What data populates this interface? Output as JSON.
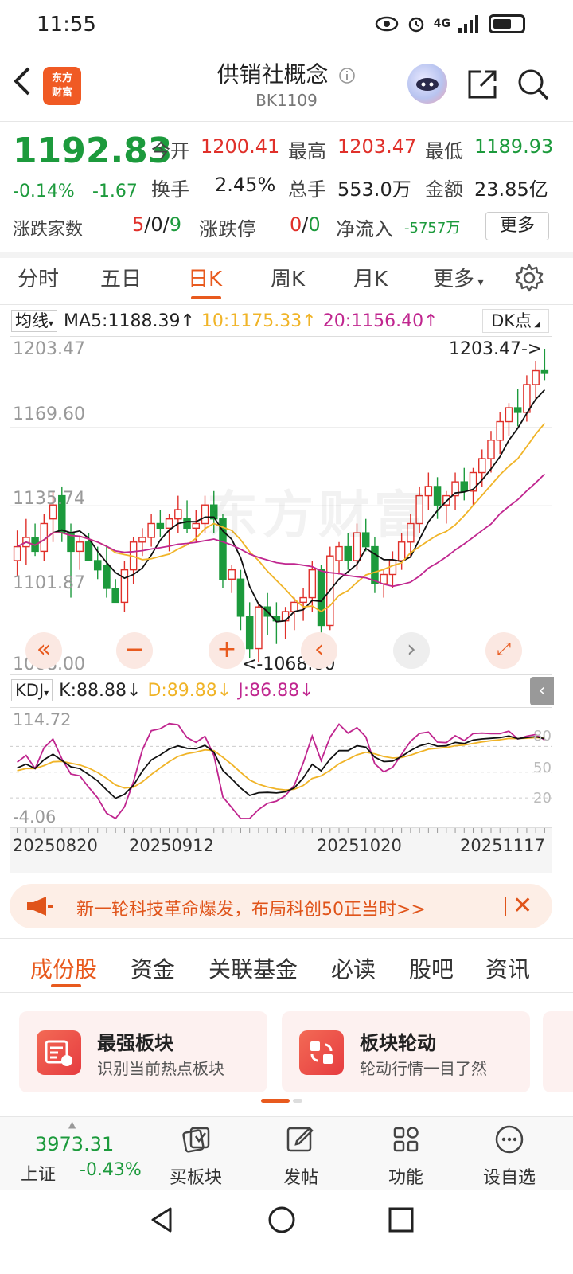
{
  "status": {
    "time": "11:55",
    "network": "4G"
  },
  "header": {
    "logo_line1": "东方",
    "logo_line2": "财富",
    "title": "供销社概念",
    "code": "BK1109",
    "icons": [
      "back-arrow-icon",
      "info-icon",
      "assistant-avatar",
      "share-icon",
      "search-icon"
    ]
  },
  "quote": {
    "price": "1192.83",
    "change_pct": "-0.14%",
    "change_abs": "-1.67",
    "open_label": "今开",
    "open": "1200.41",
    "high_label": "最高",
    "high": "1203.47",
    "low_label": "最低",
    "low": "1189.93",
    "turnover_label": "换手",
    "turnover": "2.45%",
    "volume_label": "总手",
    "volume": "553.0万",
    "amount_label": "金额",
    "amount": "23.85亿",
    "breadth_label": "涨跌家数",
    "breadth_up": "5",
    "breadth_flat": "0",
    "breadth_down": "9",
    "limit_label": "涨跌停",
    "limit_up": "0",
    "limit_down": "0",
    "netflow_label": "净流入",
    "netflow": "-5757万",
    "more_label": "更多",
    "colors": {
      "up": "#e0302a",
      "down": "#1c9a3c"
    }
  },
  "period_tabs": [
    "分时",
    "五日",
    "日K",
    "周K",
    "月K",
    "更多"
  ],
  "active_period": "日K",
  "ma": {
    "selector": "均线",
    "ma5": "MA5:1188.39",
    "ma10": "10:1175.33",
    "ma20": "20:1156.40",
    "dk_label": "DK点",
    "colors": {
      "ma5": "#111111",
      "ma10": "#f0b428",
      "ma20": "#c0268f"
    }
  },
  "kline": {
    "y_labels": [
      "1203.47",
      "1169.60",
      "1135.74",
      "1101.87",
      "1068.00"
    ],
    "max_marker": "1203.47->",
    "min_marker": "<-1068.00",
    "watermark": "东方财富"
  },
  "kdj": {
    "selector": "KDJ",
    "k": "K:88.88",
    "d": "D:89.88",
    "j": "J:86.88",
    "y_top": "114.72",
    "y_bottom": "-4.06",
    "y_ticks": [
      "80",
      "50",
      "20"
    ]
  },
  "chart_data": {
    "type": "candlestick",
    "title": "供销社概念 BK1109 日K",
    "y_range": [
      1068.0,
      1203.47
    ],
    "x_labels": [
      "20250820",
      "20250912",
      "20251020",
      "20251117"
    ],
    "ohlc_approx": [
      [
        1112,
        1125,
        1105,
        1118
      ],
      [
        1118,
        1130,
        1110,
        1122
      ],
      [
        1122,
        1128,
        1114,
        1116
      ],
      [
        1116,
        1132,
        1112,
        1128
      ],
      [
        1130,
        1142,
        1120,
        1136
      ],
      [
        1140,
        1144,
        1120,
        1124
      ],
      [
        1124,
        1128,
        1096,
        1116
      ],
      [
        1116,
        1122,
        1108,
        1120
      ],
      [
        1120,
        1124,
        1112,
        1112
      ],
      [
        1112,
        1118,
        1104,
        1108
      ],
      [
        1110,
        1118,
        1096,
        1100
      ],
      [
        1100,
        1104,
        1094,
        1094
      ],
      [
        1094,
        1112,
        1090,
        1108
      ],
      [
        1108,
        1122,
        1102,
        1120
      ],
      [
        1120,
        1126,
        1114,
        1122
      ],
      [
        1122,
        1132,
        1118,
        1128
      ],
      [
        1128,
        1134,
        1122,
        1126
      ],
      [
        1126,
        1132,
        1116,
        1130
      ],
      [
        1130,
        1140,
        1124,
        1134
      ],
      [
        1130,
        1138,
        1124,
        1126
      ],
      [
        1126,
        1134,
        1120,
        1128
      ],
      [
        1128,
        1140,
        1124,
        1136
      ],
      [
        1136,
        1142,
        1124,
        1130
      ],
      [
        1130,
        1132,
        1100,
        1104
      ],
      [
        1104,
        1110,
        1098,
        1108
      ],
      [
        1104,
        1108,
        1082,
        1088
      ],
      [
        1088,
        1094,
        1070,
        1074
      ],
      [
        1074,
        1094,
        1068,
        1092
      ],
      [
        1092,
        1098,
        1080,
        1088
      ],
      [
        1088,
        1094,
        1076,
        1086
      ],
      [
        1086,
        1092,
        1078,
        1090
      ],
      [
        1090,
        1096,
        1082,
        1094
      ],
      [
        1094,
        1100,
        1086,
        1096
      ],
      [
        1096,
        1112,
        1090,
        1108
      ],
      [
        1108,
        1110,
        1080,
        1084
      ],
      [
        1084,
        1118,
        1082,
        1114
      ],
      [
        1112,
        1120,
        1106,
        1118
      ],
      [
        1118,
        1124,
        1108,
        1112
      ],
      [
        1112,
        1128,
        1108,
        1124
      ],
      [
        1124,
        1130,
        1116,
        1118
      ],
      [
        1118,
        1122,
        1098,
        1102
      ],
      [
        1102,
        1108,
        1096,
        1106
      ],
      [
        1106,
        1116,
        1100,
        1112
      ],
      [
        1112,
        1124,
        1108,
        1120
      ],
      [
        1120,
        1132,
        1114,
        1128
      ],
      [
        1128,
        1144,
        1124,
        1140
      ],
      [
        1140,
        1150,
        1134,
        1144
      ],
      [
        1144,
        1148,
        1130,
        1136
      ],
      [
        1136,
        1142,
        1128,
        1140
      ],
      [
        1140,
        1150,
        1134,
        1146
      ],
      [
        1146,
        1152,
        1138,
        1142
      ],
      [
        1142,
        1152,
        1136,
        1150
      ],
      [
        1150,
        1160,
        1144,
        1156
      ],
      [
        1156,
        1168,
        1150,
        1164
      ],
      [
        1164,
        1176,
        1158,
        1172
      ],
      [
        1172,
        1180,
        1166,
        1178
      ],
      [
        1178,
        1186,
        1170,
        1176
      ],
      [
        1176,
        1192,
        1172,
        1188
      ],
      [
        1188,
        1198,
        1182,
        1194
      ],
      [
        1194,
        1203.47,
        1189.93,
        1192.83
      ]
    ],
    "series": [
      {
        "name": "MA5",
        "last": 1188.39
      },
      {
        "name": "MA10",
        "last": 1175.33
      },
      {
        "name": "MA20",
        "last": 1156.4
      }
    ],
    "kdj_range": [
      -4.06,
      114.72
    ],
    "kdj_last": {
      "K": 88.88,
      "D": 89.88,
      "J": 86.88
    }
  },
  "dates": [
    "20250820",
    "20250912",
    "20251020",
    "20251117"
  ],
  "banner": {
    "text": "新一轮科技革命爆发，布局科创50正当时>>"
  },
  "content_tabs": [
    "成份股",
    "资金",
    "关联基金",
    "必读",
    "股吧",
    "资讯"
  ],
  "cards": [
    {
      "title": "最强板块",
      "subtitle": "识别当前热点板块"
    },
    {
      "title": "板块轮动",
      "subtitle": "轮动行情一目了然"
    }
  ],
  "bottom_bar": {
    "index_value": "3973.31",
    "index_name": "上证",
    "index_change": "-0.43%",
    "items": [
      "买板块",
      "发帖",
      "功能",
      "设自选"
    ]
  }
}
